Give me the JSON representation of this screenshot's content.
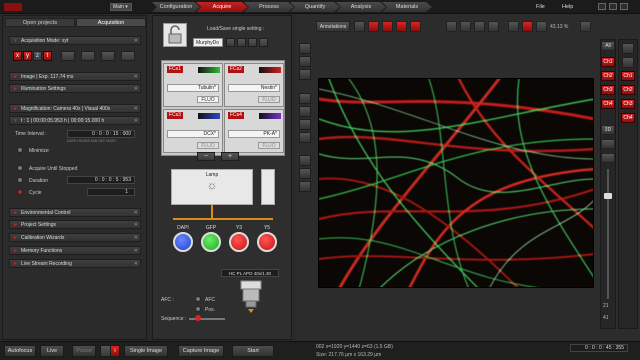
{
  "topbar": {
    "main_label": "Main",
    "workflow_tabs": [
      "Configuration",
      "Acquire",
      "Process",
      "Quantify",
      "Analysis",
      "Materials"
    ],
    "menus": [
      "File",
      "Help"
    ]
  },
  "left": {
    "tabs": [
      "Open projects",
      "Acquisition"
    ],
    "acq_mode_label": "Acquisition Mode: xyt",
    "axis_buttons": [
      "x",
      "y",
      "z",
      "t"
    ],
    "image_exp": "Image | Exp. 117.74 ms",
    "illumination": "Illumination Settings",
    "magnification": "Magnification: Camera 40x | Visual 400x",
    "timelapse_summary": "t : 1 | 00:00:05.953 h | 00:00:15.000 h",
    "time_interval_label": "Time Interval :",
    "time_interval_value": "0 : 0 : 0 : 15 : 000",
    "time_units": "DAYS HOURS MIN SEC MSEC",
    "minimize": "Minimize",
    "acquire_until_stopped": "Acquire Until Stopped",
    "duration_label": "Duration",
    "duration_value": "0 : 0 : 0 : 5 : 953",
    "cycle_label": "Cycle",
    "cycle_value": "1",
    "sections": [
      "Environmental Control",
      "Project Settings",
      "Calibration Wizards",
      "Memory Functions",
      "Live Stream Recording"
    ]
  },
  "middle": {
    "loadsave_label": "Load/Save single setting :",
    "preset_value": "MurphyDo",
    "fc": [
      {
        "label": "FCs1",
        "dye": "Tubulin*",
        "fluo": "FLUO",
        "color": "#33bb33"
      },
      {
        "label": "FCs2",
        "dye": "Nestin*",
        "fluo": "FLUO",
        "color": "#cc2222"
      },
      {
        "label": "FCs3",
        "dye": "DCX*",
        "fluo": "FLUO",
        "color": "#3344cc"
      },
      {
        "label": "FCs4",
        "dye": "PK-A*",
        "fluo": "FLUO",
        "color": "#7733cc"
      }
    ],
    "minus": "−",
    "plus": "+",
    "lamp_label": "Lamp",
    "channels": [
      {
        "label": "DAPI",
        "color": "#2244cc"
      },
      {
        "label": "GFP",
        "color": "#22aa22"
      },
      {
        "label": "Y3",
        "color": "#cc1111"
      },
      {
        "label": "Y5",
        "color": "#cc1111"
      }
    ],
    "objective_label": "HC PL APO 40x/1.30",
    "afc_label": "AFC :",
    "afc_options": [
      "AFC",
      "Pos."
    ],
    "sequence_label": "Sequence :"
  },
  "image_view": {
    "annotations_label": "Annotations",
    "zoom_value": "43.13 %",
    "side_buttons": [
      "All",
      "Ch1",
      "Ch2",
      "Ch3",
      "Ch4"
    ],
    "three_d": "3D",
    "slice_top": "21",
    "slice_bottom": "41",
    "side_label": "Ch4"
  },
  "bottom": {
    "autofocus": "Autofocus",
    "live": "Live",
    "pause": "Pause",
    "single_image": "Single Image",
    "capture_image": "Capture Image",
    "start": "Start",
    "px_label": "px",
    "info_line1": "002 x=1920 y=1440 z=63 (1.5 GB)",
    "info_line2": "Size: 217.76 µm x 163.29 µm",
    "time_readout": "0 : 0 : 0 : 45 : 355"
  }
}
